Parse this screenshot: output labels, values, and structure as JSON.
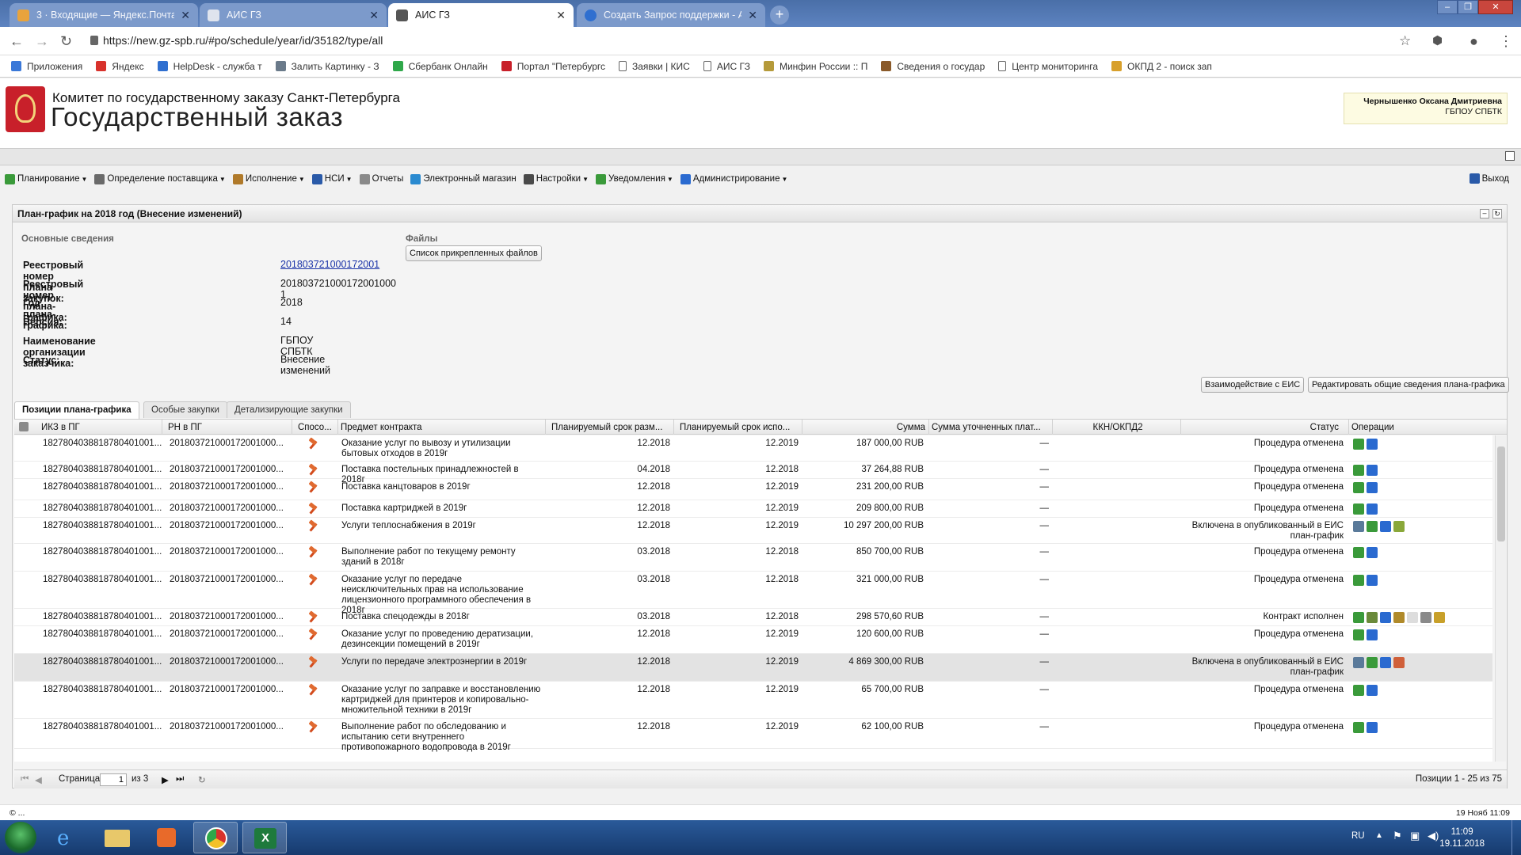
{
  "browser": {
    "tabs": [
      {
        "title": "3 · Входящие — Яндекс.Почта",
        "icon": "mail-icon",
        "color": "#e8a33c",
        "active": false
      },
      {
        "title": "АИС ГЗ",
        "icon": "page-icon",
        "color": "#dfe4ee",
        "active": false
      },
      {
        "title": "АИС ГЗ",
        "icon": "page-icon",
        "color": "#555555",
        "active": true
      },
      {
        "title": "Создать Запрос поддержки - А",
        "icon": "helpdesk-icon",
        "color": "#2f6fd0",
        "active": false
      }
    ],
    "url": "https://new.gz-spb.ru/#po/schedule/year/id/35182/type/all",
    "bookmarks": [
      {
        "label": "Приложения",
        "color": "#3a78d8"
      },
      {
        "label": "Яндекс",
        "color": "#d8322c"
      },
      {
        "label": "HelpDesk - служба т",
        "color": "#2f6fd0"
      },
      {
        "label": "Залить Картинку - З",
        "color": "#6a7a8a"
      },
      {
        "label": "Сбербанк Онлайн",
        "color": "#2fa84a"
      },
      {
        "label": "Портал \"Петербургс",
        "color": "#c8202a"
      },
      {
        "label": "Заявки | КИС",
        "color": "#ffffff"
      },
      {
        "label": "АИС ГЗ",
        "color": "#ffffff"
      },
      {
        "label": "Минфин России :: П",
        "color": "#b59a3a"
      },
      {
        "label": "Сведения о государ",
        "color": "#8a5a2a"
      },
      {
        "label": "Центр мониторинга",
        "color": "#ffffff"
      },
      {
        "label": "ОКПД 2 - поиск зап",
        "color": "#d8a02c"
      }
    ]
  },
  "header": {
    "org_line1": "Комитет по государственному заказу Санкт-Петербурга",
    "org_line2": "Государственный заказ",
    "user_name": "Чернышенко Оксана Дмитриевна",
    "user_org": "ГБПОУ СПБТК"
  },
  "menu": {
    "items": [
      {
        "label": "Планирование",
        "dropdown": true,
        "color": "#3a9a3a"
      },
      {
        "label": "Определение поставщика",
        "dropdown": true,
        "color": "#6a6a6a"
      },
      {
        "label": "Исполнение",
        "dropdown": true,
        "color": "#b07a2a"
      },
      {
        "label": "НСИ",
        "dropdown": true,
        "color": "#2a5aa8"
      },
      {
        "label": "Отчеты",
        "dropdown": false,
        "color": "#8a8a8a"
      },
      {
        "label": "Электронный магазин",
        "dropdown": false,
        "color": "#2a8ad0"
      },
      {
        "label": "Настройки",
        "dropdown": true,
        "color": "#4a4a4a"
      },
      {
        "label": "Уведомления",
        "dropdown": true,
        "color": "#3a9a3a"
      },
      {
        "label": "Администрирование",
        "dropdown": true,
        "color": "#2a6ad0"
      }
    ],
    "logout": "Выход"
  },
  "panel": {
    "title": "План-график на 2018 год (Внесение изменений)",
    "section_main": "Основные сведения",
    "section_files": "Файлы",
    "files_button": "Список прикрепленных файлов",
    "fields": [
      {
        "label": "Реестровый номер плана закупок:",
        "value": "201803721000172001",
        "link": true
      },
      {
        "label": "Реестровый номер плана-графика:",
        "value": "201803721000172001000 1"
      },
      {
        "label": "Год плана-графика:",
        "value": "2018"
      },
      {
        "label": "Версия:",
        "value": "14"
      },
      {
        "label": "Наименование организации заказчика:",
        "value": "ГБПОУ СПБТК"
      },
      {
        "label": "Статус:",
        "value": "Внесение изменений"
      }
    ],
    "btn_eis": "Взаимодействие с ЕИС",
    "btn_edit": "Редактировать общие сведения плана-графика",
    "tabs": [
      "Позиции плана-графика",
      "Особые закупки",
      "Детализирующие закупки"
    ]
  },
  "grid": {
    "columns": [
      "ИКЗ в ПГ",
      "РН в ПГ",
      "Спосо...",
      "Предмет контракта",
      "Планируемый срок разм...",
      "Планируемый срок испо...",
      "Сумма",
      "Сумма уточненных плат...",
      "ККН/ОКПД2",
      "Статус",
      "Операции"
    ],
    "rows": [
      {
        "ikz": "1827804038818780401001...",
        "rn": "201803721000172001000...",
        "subject": "Оказание услуг по вывозу и утилизации бытовых отходов в 2019г",
        "placement": "12.2018",
        "execution": "12.2019",
        "sum": "187 000,00 RUB",
        "refined": "—",
        "status": "Процедура отменена",
        "ops": [
          "#3a9a3a",
          "#2a6ad0"
        ]
      },
      {
        "ikz": "1827804038818780401001...",
        "rn": "201803721000172001000...",
        "subject": "Поставка постельных принадлежностей в 2018г",
        "placement": "04.2018",
        "execution": "12.2018",
        "sum": "37 264,88 RUB",
        "refined": "—",
        "status": "Процедура отменена",
        "ops": [
          "#3a9a3a",
          "#2a6ad0"
        ]
      },
      {
        "ikz": "1827804038818780401001...",
        "rn": "201803721000172001000...",
        "subject": "Поставка канцтоваров в 2019г",
        "placement": "12.2018",
        "execution": "12.2019",
        "sum": "231 200,00 RUB",
        "refined": "—",
        "status": "Процедура отменена",
        "ops": [
          "#3a9a3a",
          "#2a6ad0"
        ]
      },
      {
        "ikz": "1827804038818780401001...",
        "rn": "201803721000172001000...",
        "subject": "Поставка картриджей в 2019г",
        "placement": "12.2018",
        "execution": "12.2019",
        "sum": "209 800,00 RUB",
        "refined": "—",
        "status": "Процедура отменена",
        "ops": [
          "#3a9a3a",
          "#2a6ad0"
        ]
      },
      {
        "ikz": "1827804038818780401001...",
        "rn": "201803721000172001000...",
        "subject": "Услуги теплоснабжения в 2019г",
        "placement": "12.2018",
        "execution": "12.2019",
        "sum": "10 297 200,00 RUB",
        "refined": "—",
        "status": "Включена в опубликованный в ЕИС план-график",
        "ops": [
          "#5a7a9a",
          "#3a9a3a",
          "#2a6ad0",
          "#8aa83a"
        ]
      },
      {
        "ikz": "1827804038818780401001...",
        "rn": "201803721000172001000...",
        "subject": "Выполнение работ по текущему ремонту зданий в 2018г",
        "placement": "03.2018",
        "execution": "12.2018",
        "sum": "850 700,00 RUB",
        "refined": "—",
        "status": "Процедура отменена",
        "ops": [
          "#3a9a3a",
          "#2a6ad0"
        ]
      },
      {
        "ikz": "1827804038818780401001...",
        "rn": "201803721000172001000...",
        "subject": "Оказание услуг по передаче неисключительных прав на использование лицензионного программного обеспечения в 2018г",
        "placement": "03.2018",
        "execution": "12.2018",
        "sum": "321 000,00 RUB",
        "refined": "—",
        "status": "Процедура отменена",
        "ops": [
          "#3a9a3a",
          "#2a6ad0"
        ]
      },
      {
        "ikz": "1827804038818780401001...",
        "rn": "201803721000172001000...",
        "subject": "Поставка спецодежды в 2018г",
        "placement": "03.2018",
        "execution": "12.2018",
        "sum": "298 570,60 RUB",
        "refined": "—",
        "status": "Контракт исполнен",
        "ops": [
          "#3a9a3a",
          "#6a8a3a",
          "#2a6ad0",
          "#b08a2a",
          "#dddddd",
          "#8a8a8a",
          "#c8a02a"
        ]
      },
      {
        "ikz": "1827804038818780401001...",
        "rn": "201803721000172001000...",
        "subject": "Оказание услуг по проведению дератизации, дезинсекции помещений в 2019г",
        "placement": "12.2018",
        "execution": "12.2019",
        "sum": "120 600,00 RUB",
        "refined": "—",
        "status": "Процедура отменена",
        "ops": [
          "#3a9a3a",
          "#2a6ad0"
        ]
      },
      {
        "ikz": "1827804038818780401001...",
        "rn": "201803721000172001000...",
        "subject": "Услуги по передаче электроэнергии в 2019г",
        "placement": "12.2018",
        "execution": "12.2019",
        "sum": "4 869 300,00 RUB",
        "refined": "—",
        "status": "Включена в опубликованный в ЕИС план-график",
        "ops": [
          "#5a7a9a",
          "#3a9a3a",
          "#2a6ad0",
          "#d0603a"
        ]
      },
      {
        "ikz": "1827804038818780401001...",
        "rn": "201803721000172001000...",
        "subject": "Оказание услуг по заправке и восстановлению картриджей для принтеров и копировально-множительной техники в 2019г",
        "placement": "12.2018",
        "execution": "12.2019",
        "sum": "65 700,00 RUB",
        "refined": "—",
        "status": "Процедура отменена",
        "ops": [
          "#3a9a3a",
          "#2a6ad0"
        ]
      },
      {
        "ikz": "1827804038818780401001...",
        "rn": "201803721000172001000...",
        "subject": "Выполнение работ по обследованию и испытанию сети внутреннего противопожарного водопровода в 2019г",
        "placement": "12.2018",
        "execution": "12.2019",
        "sum": "62 100,00 RUB",
        "refined": "—",
        "status": "Процедура отменена",
        "ops": [
          "#3a9a3a",
          "#2a6ad0"
        ]
      }
    ]
  },
  "pager": {
    "page_label": "Страница",
    "page_value": "1",
    "of_label": "из 3",
    "summary": "Позиции 1 - 25 из 75"
  },
  "status_bar": {
    "left": "© ...",
    "right": "19 Нояб 11:09"
  },
  "taskbar": {
    "lang": "RU",
    "time": "11:09",
    "date": "19.11.2018"
  }
}
